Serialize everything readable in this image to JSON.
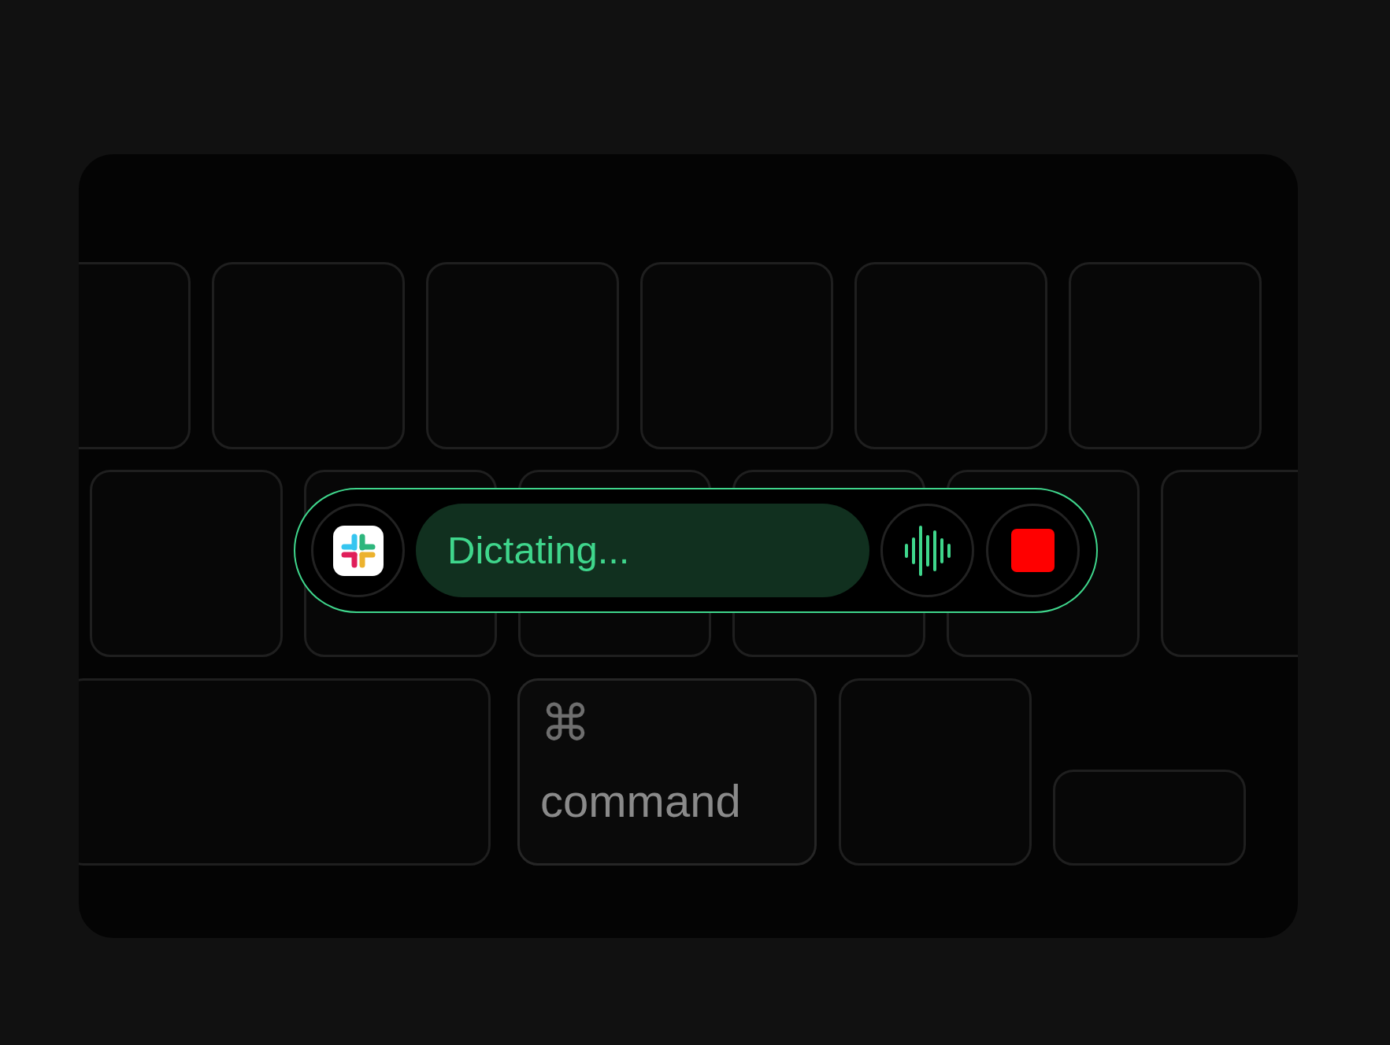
{
  "dictation_bar": {
    "status": "Dictating..."
  },
  "keyboard": {
    "command_key": {
      "symbol": "⌘",
      "label": "command"
    }
  }
}
